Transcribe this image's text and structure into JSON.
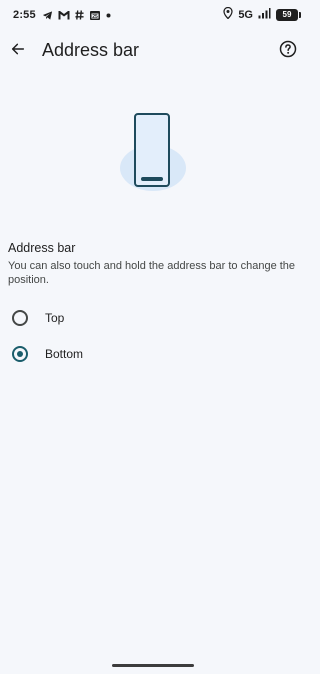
{
  "status_bar": {
    "time": "2:55",
    "network": "5G",
    "battery": "59",
    "icons": [
      "telegram-icon",
      "gmail-icon",
      "hashtag-icon",
      "calendar-icon",
      "dot-icon",
      "location-icon",
      "signal-icon",
      "battery-icon"
    ]
  },
  "app_bar": {
    "title": "Address bar",
    "back_icon": "arrow-back-icon",
    "help_icon": "help-circle-icon"
  },
  "illustration": {
    "icon": "phone-with-bottom-address-bar-icon"
  },
  "setting": {
    "title": "Address bar",
    "description": "You can also touch and hold the address bar to change the position.",
    "options": [
      {
        "label": "Top",
        "selected": false
      },
      {
        "label": "Bottom",
        "selected": true
      }
    ]
  },
  "colors": {
    "background": "#f5f7fb",
    "accent": "#1a5d6b",
    "illustration_glow": "#d6e6f7",
    "phone_screen": "#e3eefb"
  }
}
